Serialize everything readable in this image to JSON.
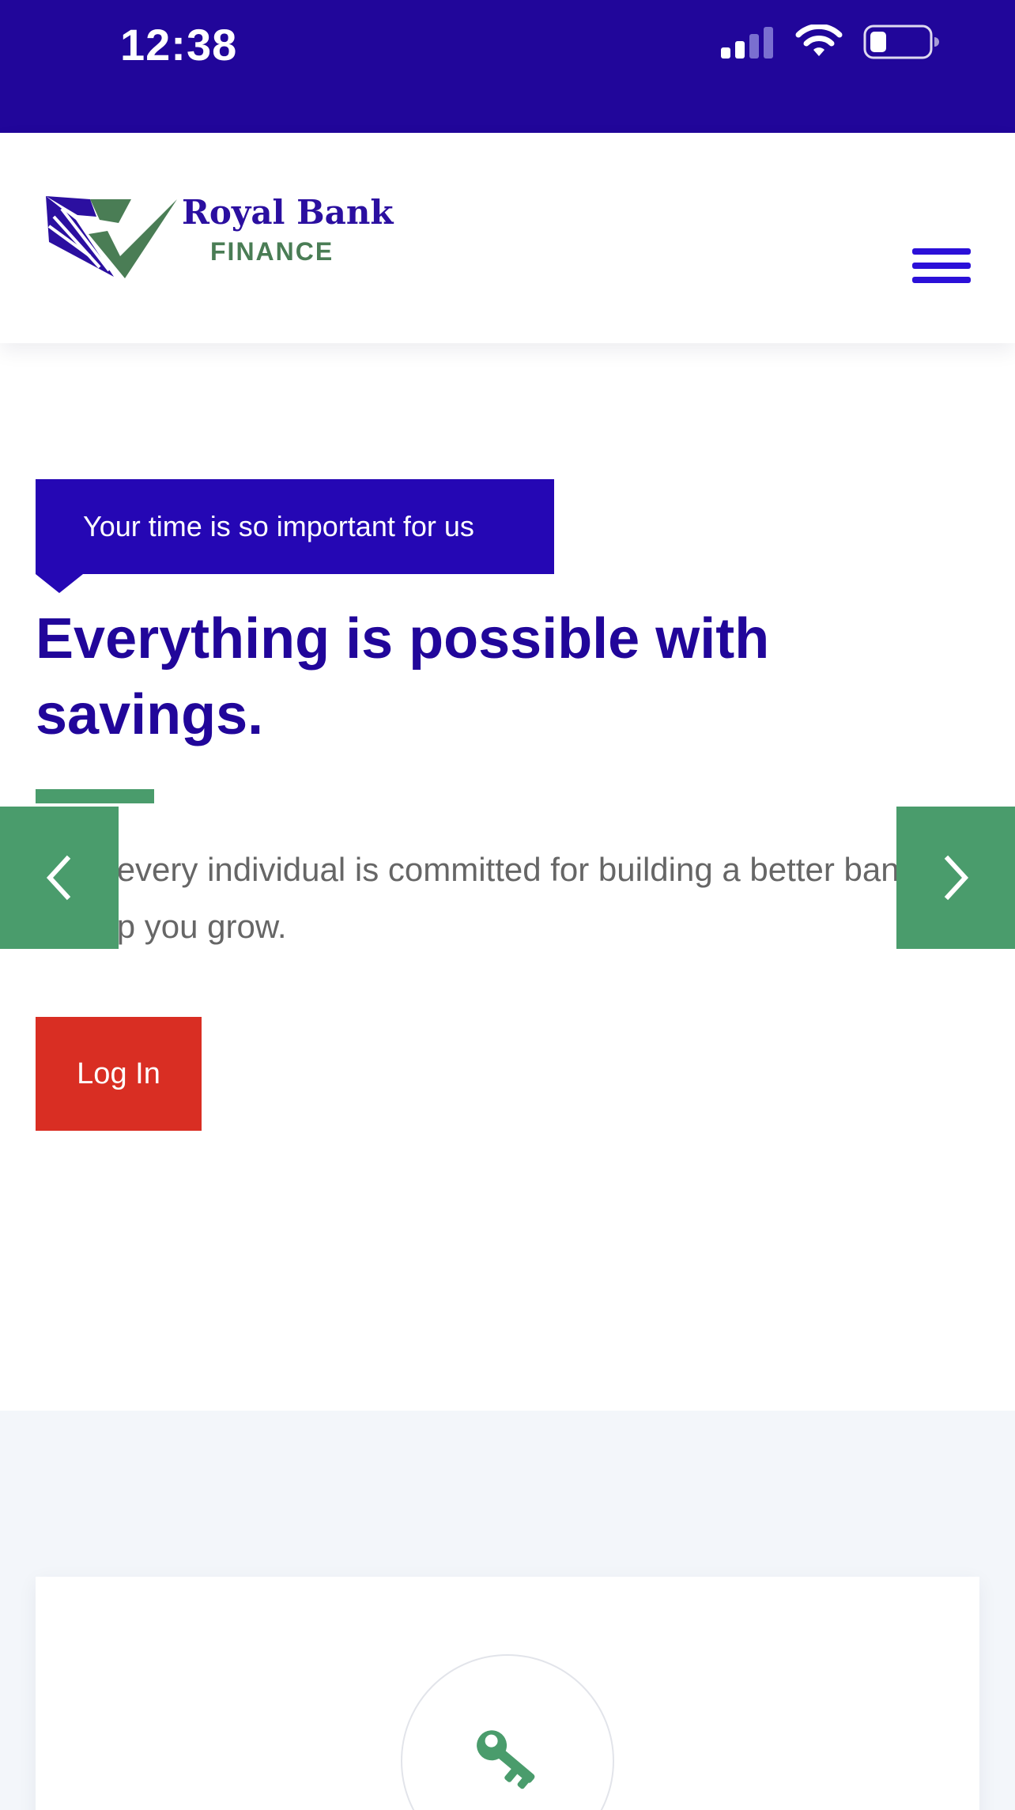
{
  "status_bar": {
    "time": "12:38",
    "icons": [
      "cellular-signal-icon",
      "wifi-icon",
      "battery-icon"
    ]
  },
  "header": {
    "logo_name": "Royal Bank",
    "logo_sub": "FINANCE",
    "menu_icon": "hamburger-menu-icon"
  },
  "hero": {
    "tagline": "Your time is so important for us",
    "title": "Everything is possible with savings.",
    "description": "Here every individual is committed for building a better banking to help you grow.",
    "login_label": "Log In",
    "prev_icon": "chevron-left-icon",
    "next_icon": "chevron-right-icon"
  },
  "features": {
    "card_icon": "key-icon"
  },
  "colors": {
    "primary": "#21069a",
    "tag_background": "#2507b4",
    "accent_green": "#4a9c6c",
    "login_red": "#d92e23",
    "section_background": "#f3f6fa"
  }
}
